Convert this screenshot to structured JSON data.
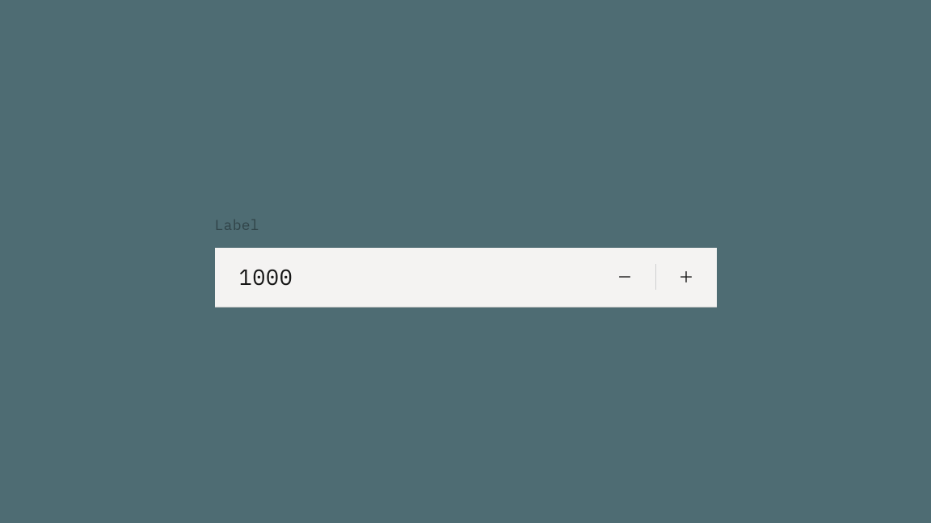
{
  "stepper": {
    "label": "Label",
    "value": "1000",
    "icons": {
      "decrement": "subtract-icon",
      "increment": "add-icon"
    }
  }
}
